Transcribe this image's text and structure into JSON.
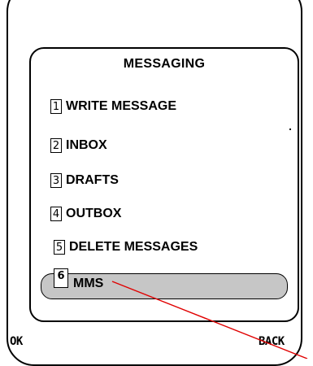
{
  "screen": {
    "title": "MESSAGING"
  },
  "menu": {
    "items": [
      {
        "number": "1",
        "label": "WRITE MESSAGE"
      },
      {
        "number": "2",
        "label": "INBOX"
      },
      {
        "number": "3",
        "label": "DRAFTS"
      },
      {
        "number": "4",
        "label": "OUTBOX"
      },
      {
        "number": "5",
        "label": "DELETE MESSAGES"
      },
      {
        "number": "6",
        "label": "MMS"
      }
    ],
    "selected_index": 5
  },
  "softkeys": {
    "left": "OK",
    "right": "BACK"
  },
  "colors": {
    "highlight": "#c6c6c6",
    "pointer_line": "#e00000"
  }
}
